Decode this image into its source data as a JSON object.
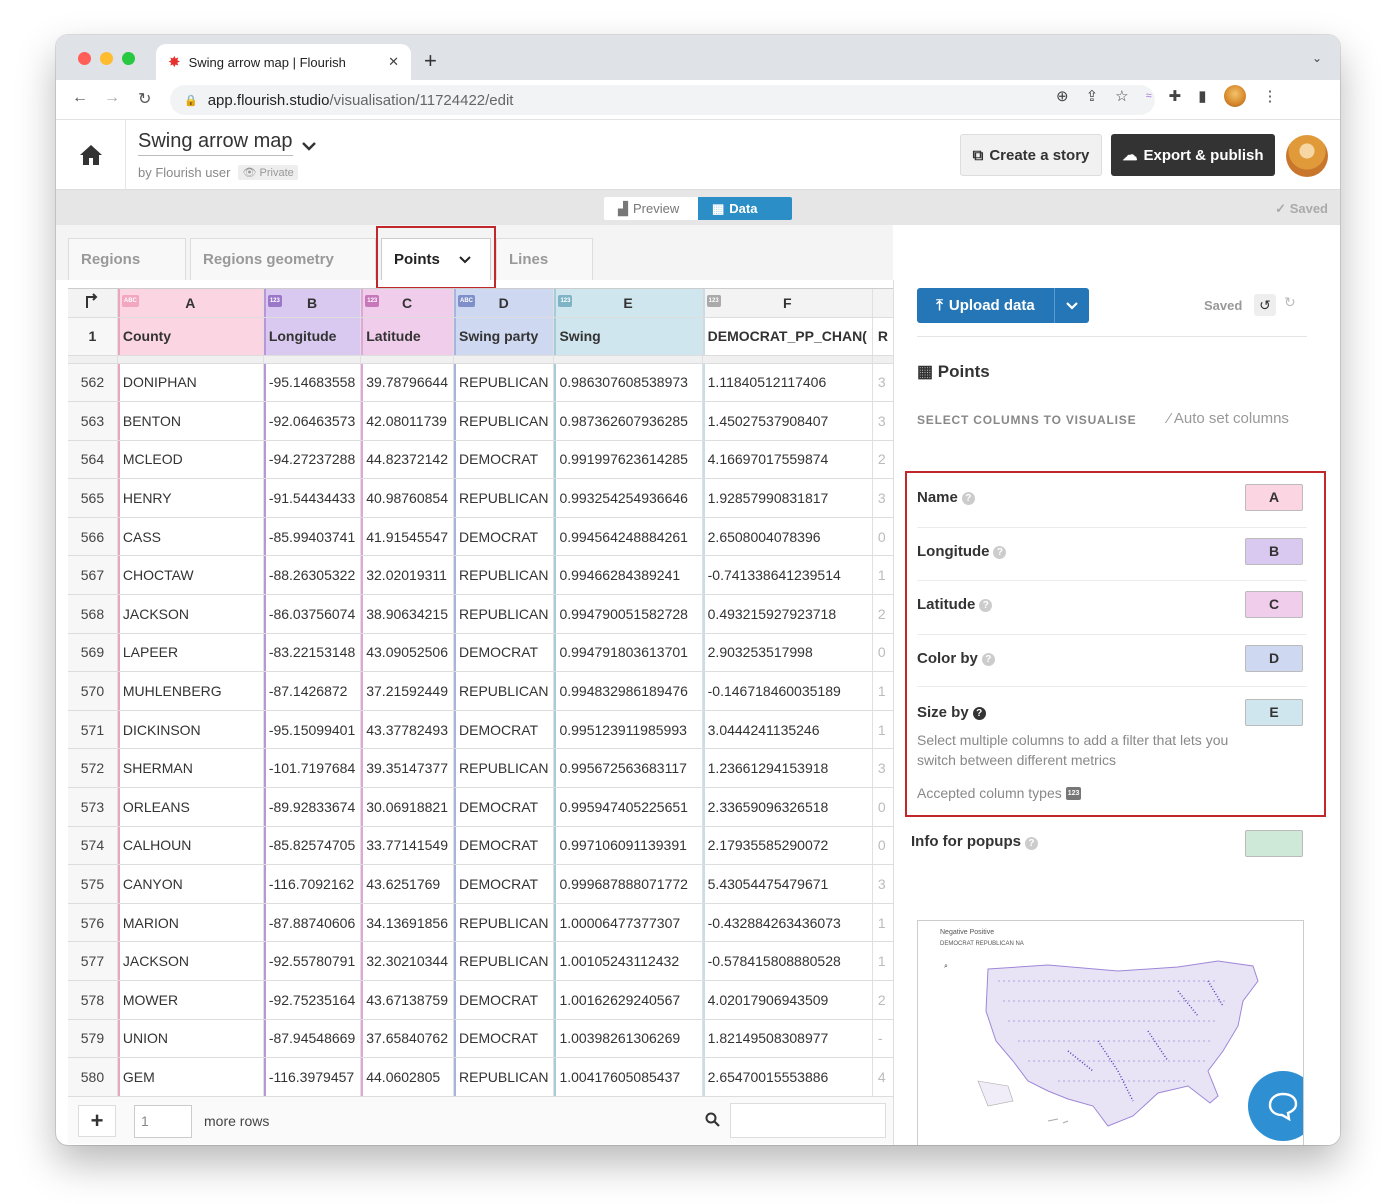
{
  "browser": {
    "tab_title": "Swing arrow map | Flourish",
    "url_host": "app.flourish.studio",
    "url_path": "/visualisation/11724422/edit"
  },
  "app": {
    "title": "Swing arrow map",
    "byline": "by Flourish user",
    "privacy": "Private",
    "create_story": "Create a story",
    "export_publish": "Export & publish",
    "view_preview": "Preview",
    "view_data": "Data",
    "saved_status": "Saved"
  },
  "sheet_tabs": [
    "Regions",
    "Regions geometry",
    "Points",
    "Lines"
  ],
  "grid": {
    "column_letters": [
      "A",
      "B",
      "C",
      "D",
      "E",
      "F"
    ],
    "column_types": [
      "ABC",
      "123",
      "123",
      "ABC",
      "123",
      "123"
    ],
    "header_row_number": "1",
    "headers": [
      "County",
      "Longitude",
      "Latitude",
      "Swing party",
      "Swing",
      "DEMOCRAT_PP_CHAN(",
      "R"
    ],
    "rows": [
      [
        "562",
        "DONIPHAN",
        "-95.14683558",
        "39.78796644",
        "REPUBLICAN",
        "0.986307608538973",
        "1.11840512117406",
        "3"
      ],
      [
        "563",
        "BENTON",
        "-92.06463573",
        "42.08011739",
        "REPUBLICAN",
        "0.987362607936285",
        "1.45027537908407",
        "3"
      ],
      [
        "564",
        "MCLEOD",
        "-94.27237288",
        "44.82372142",
        "DEMOCRAT",
        "0.991997623614285",
        "4.16697017559874",
        "2"
      ],
      [
        "565",
        "HENRY",
        "-91.54434433",
        "40.98760854",
        "REPUBLICAN",
        "0.993254254936646",
        "1.92857990831817",
        "3"
      ],
      [
        "566",
        "CASS",
        "-85.99403741",
        "41.91545547",
        "DEMOCRAT",
        "0.994564248884261",
        "2.6508004078396",
        "0"
      ],
      [
        "567",
        "CHOCTAW",
        "-88.26305322",
        "32.02019311",
        "REPUBLICAN",
        "0.99466284389241",
        "-0.741338641239514",
        "1"
      ],
      [
        "568",
        "JACKSON",
        "-86.03756074",
        "38.90634215",
        "REPUBLICAN",
        "0.994790051582728",
        "0.493215927923718",
        "2"
      ],
      [
        "569",
        "LAPEER",
        "-83.22153148",
        "43.09052506",
        "DEMOCRAT",
        "0.994791803613701",
        "2.903253517998",
        "0"
      ],
      [
        "570",
        "MUHLENBERG",
        "-87.1426872",
        "37.21592449",
        "REPUBLICAN",
        "0.994832986189476",
        "-0.146718460035189",
        "1"
      ],
      [
        "571",
        "DICKINSON",
        "-95.15099401",
        "43.37782493",
        "DEMOCRAT",
        "0.995123911985993",
        "3.0444241135246",
        "1"
      ],
      [
        "572",
        "SHERMAN",
        "-101.7197684",
        "39.35147377",
        "REPUBLICAN",
        "0.995672563683117",
        "1.23661294153918",
        "3"
      ],
      [
        "573",
        "ORLEANS",
        "-89.92833674",
        "30.06918821",
        "DEMOCRAT",
        "0.995947405225651",
        "2.33659096326518",
        "0"
      ],
      [
        "574",
        "CALHOUN",
        "-85.82574705",
        "33.77141549",
        "DEMOCRAT",
        "0.997106091139391",
        "2.17935585290072",
        "0"
      ],
      [
        "575",
        "CANYON",
        "-116.7092162",
        "43.6251769",
        "DEMOCRAT",
        "0.999687888071772",
        "5.43054475479671",
        "3"
      ],
      [
        "576",
        "MARION",
        "-87.88740606",
        "34.13691856",
        "REPUBLICAN",
        "1.00006477377307",
        "-0.432884263436073",
        "1"
      ],
      [
        "577",
        "JACKSON",
        "-92.55780791",
        "32.30210344",
        "REPUBLICAN",
        "1.00105243112432",
        "-0.578415808880528",
        "1"
      ],
      [
        "578",
        "MOWER",
        "-92.75235164",
        "43.67138759",
        "DEMOCRAT",
        "1.00162629240567",
        "4.02017906943509",
        "2"
      ],
      [
        "579",
        "UNION",
        "-87.94548669",
        "37.65840762",
        "DEMOCRAT",
        "1.00398261306269",
        "1.82149508308977",
        "-"
      ],
      [
        "580",
        "GEM",
        "-116.3979457",
        "44.0602805",
        "REPUBLICAN",
        "1.00417605085437",
        "2.65470015553886",
        "4"
      ]
    ],
    "add_rows_value": "1",
    "more_rows": "more rows"
  },
  "panel": {
    "upload_data": "Upload data",
    "saved": "Saved",
    "title": "Points",
    "select_columns": "SELECT COLUMNS TO VISUALISE",
    "auto_set": "Auto set columns",
    "bindings": [
      {
        "label": "Name",
        "value": "A",
        "color": "#fbd6e2"
      },
      {
        "label": "Longitude",
        "value": "B",
        "color": "#d9c8ef"
      },
      {
        "label": "Latitude",
        "value": "C",
        "color": "#f0cdea"
      },
      {
        "label": "Color by",
        "value": "D",
        "color": "#cfd8f1"
      },
      {
        "label": "Size by",
        "value": "E",
        "color": "#cfe6ee"
      }
    ],
    "size_help": "Select multiple columns to add a filter that lets you switch between different metrics",
    "accepted_types": "Accepted column types",
    "accepted_badge": "123",
    "info_popups": "Info for popups",
    "preview_legend_arrows": "Negative   Positive",
    "preview_legend_parties": "DEMOCRAT  REPUBLICAN  NA"
  },
  "colors": {
    "accent_blue": "#2576b7",
    "data_tab": "#2b8ec6",
    "highlight_red": "#c0282c",
    "popup_chip": "#cfe9d8"
  }
}
